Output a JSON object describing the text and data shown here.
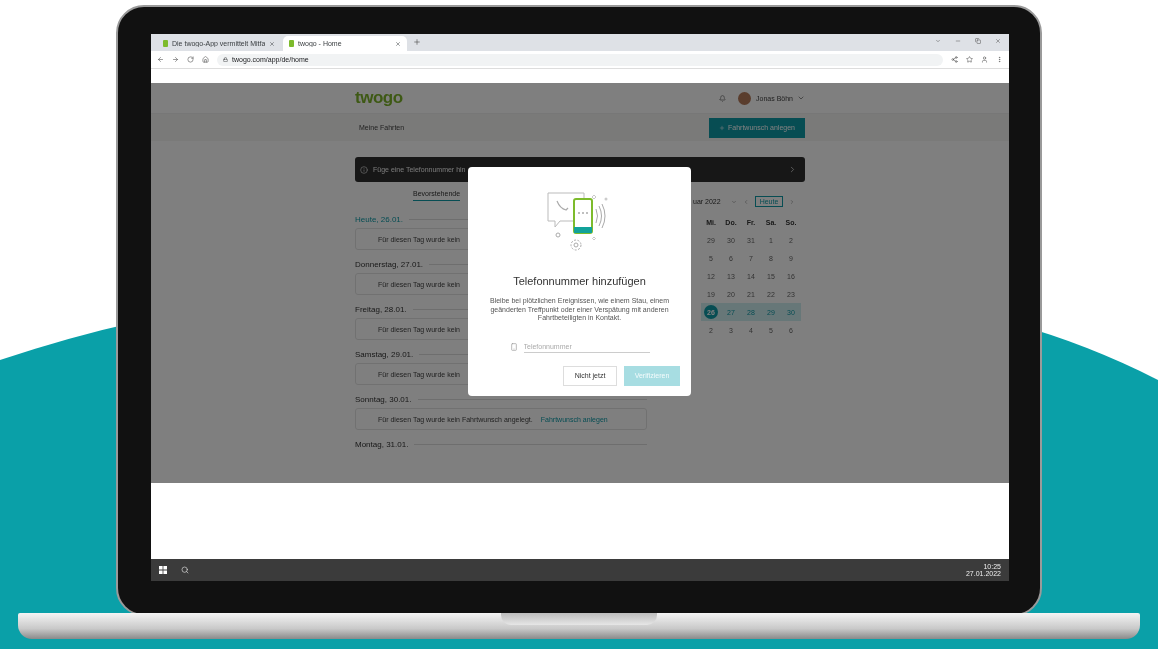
{
  "browser": {
    "tabs": [
      {
        "title": "Die twogo-App vermittelt Mitfa",
        "selected": false
      },
      {
        "title": "twogo - Home",
        "selected": true
      }
    ],
    "url": "twogo.com/app/de/home"
  },
  "app": {
    "logo": "twogo",
    "user_name": "Jonas Böhn",
    "page_title": "Meine Fahrten",
    "primary_button": "Fahrtwunsch anlegen",
    "banner": "Füge eine Telefonnummer hin",
    "tabs": [
      {
        "label": "Bevorstehende",
        "selected": true
      }
    ],
    "days": [
      {
        "label": "Heute, 26.01.",
        "today": true,
        "message": "Für diesen Tag wurde kein"
      },
      {
        "label": "Donnerstag, 27.01.",
        "today": false,
        "message": "Für diesen Tag wurde kein"
      },
      {
        "label": "Freitag, 28.01.",
        "today": false,
        "message": "Für diesen Tag wurde kein"
      },
      {
        "label": "Samstag, 29.01.",
        "today": false,
        "message": "Für diesen Tag wurde kein"
      },
      {
        "label": "Sonntag, 30.01.",
        "today": false,
        "message": "Für diesen Tag wurde kein Fahrtwunsch angelegt.",
        "link": "Fahrtwunsch anlegen"
      },
      {
        "label": "Montag, 31.01.",
        "today": false
      }
    ],
    "calendar": {
      "month": "uar 2022",
      "today_button": "Heute",
      "weekdays": [
        "Mi.",
        "Do.",
        "Fr.",
        "Sa.",
        "So."
      ],
      "weeks": [
        {
          "highlighted": false,
          "days": [
            {
              "label": "29",
              "selected": false
            },
            {
              "label": "30",
              "selected": false
            },
            {
              "label": "31",
              "selected": false
            },
            {
              "label": "1",
              "selected": false
            },
            {
              "label": "2",
              "selected": false
            }
          ]
        },
        {
          "highlighted": false,
          "days": [
            {
              "label": "5",
              "selected": false
            },
            {
              "label": "6",
              "selected": false
            },
            {
              "label": "7",
              "selected": false
            },
            {
              "label": "8",
              "selected": false
            },
            {
              "label": "9",
              "selected": false
            }
          ]
        },
        {
          "highlighted": false,
          "days": [
            {
              "label": "12",
              "selected": false
            },
            {
              "label": "13",
              "selected": false
            },
            {
              "label": "14",
              "selected": false
            },
            {
              "label": "15",
              "selected": false
            },
            {
              "label": "16",
              "selected": false
            }
          ]
        },
        {
          "highlighted": false,
          "days": [
            {
              "label": "19",
              "selected": false
            },
            {
              "label": "20",
              "selected": false
            },
            {
              "label": "21",
              "selected": false
            },
            {
              "label": "22",
              "selected": false
            },
            {
              "label": "23",
              "selected": false
            }
          ]
        },
        {
          "highlighted": true,
          "days": [
            {
              "label": "26",
              "selected": true
            },
            {
              "label": "27",
              "selected": false
            },
            {
              "label": "28",
              "selected": false
            },
            {
              "label": "29",
              "selected": false
            },
            {
              "label": "30",
              "selected": false
            }
          ]
        },
        {
          "highlighted": false,
          "days": [
            {
              "label": "2",
              "selected": false
            },
            {
              "label": "3",
              "selected": false
            },
            {
              "label": "4",
              "selected": false
            },
            {
              "label": "5",
              "selected": false
            },
            {
              "label": "6",
              "selected": false
            }
          ]
        }
      ]
    }
  },
  "modal": {
    "title": "Telefonnummer hinzufügen",
    "text": "Bleibe bei plötzlichen Ereignissen, wie einem Stau, einem geänderten Treffpunkt oder einer Verspätung mit anderen Fahrtbeteiligten in Kontakt.",
    "phone_placeholder": "Telefonnummer",
    "buttons": [
      {
        "label": "Nicht jetzt",
        "kind": "secondary",
        "disabled": false
      },
      {
        "label": "Verifizieren",
        "kind": "primary",
        "disabled": true
      }
    ]
  },
  "taskbar": {
    "time": "10:25",
    "date": "27.01.2022"
  }
}
